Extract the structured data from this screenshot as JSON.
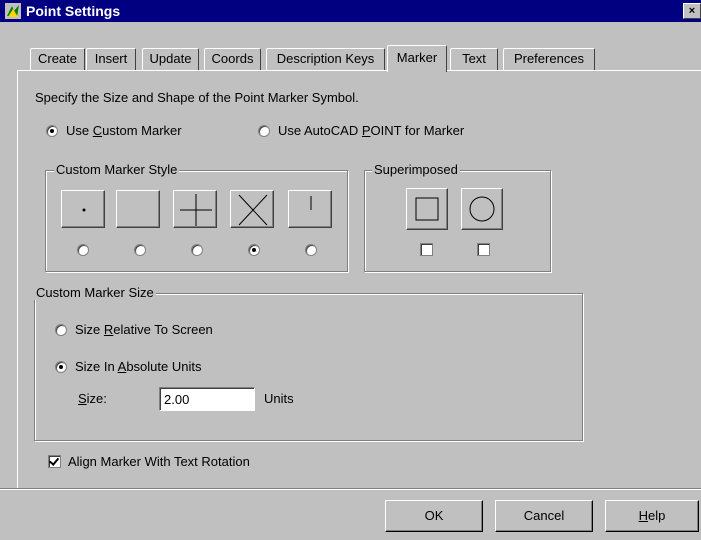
{
  "window": {
    "title": "Point Settings",
    "close_glyph": "×"
  },
  "tabs": [
    {
      "label": "Create",
      "active": false
    },
    {
      "label": "Insert",
      "active": false
    },
    {
      "label": "Update",
      "active": false
    },
    {
      "label": "Coords",
      "active": false
    },
    {
      "label": "Description Keys",
      "active": false
    },
    {
      "label": "Marker",
      "active": true
    },
    {
      "label": "Text",
      "active": false
    },
    {
      "label": "Preferences",
      "active": false
    }
  ],
  "instruction": "Specify the Size and Shape of the Point Marker Symbol.",
  "marker_source": {
    "custom": {
      "pre": "Use ",
      "accel": "C",
      "post": "ustom Marker",
      "selected": true
    },
    "autocad": {
      "pre": "Use AutoCAD ",
      "accel": "P",
      "post": "OINT for Marker",
      "selected": false
    }
  },
  "custom_marker_style": {
    "label": "Custom Marker Style",
    "options": [
      {
        "icon": "dot-marker-icon",
        "selected": false
      },
      {
        "icon": "blank-marker-icon",
        "selected": false
      },
      {
        "icon": "plus-marker-icon",
        "selected": false
      },
      {
        "icon": "cross-marker-icon",
        "selected": true
      },
      {
        "icon": "tick-marker-icon",
        "selected": false
      }
    ]
  },
  "superimposed": {
    "label": "Superimposed",
    "options": [
      {
        "icon": "square-marker-icon",
        "checked": false
      },
      {
        "icon": "circle-marker-icon",
        "checked": false
      }
    ]
  },
  "custom_marker_size": {
    "label": "Custom Marker Size",
    "relative": {
      "pre": "Size ",
      "accel": "R",
      "post": "elative To Screen",
      "selected": false
    },
    "absolute": {
      "pre": "Size In ",
      "accel": "A",
      "post": "bsolute Units",
      "selected": true
    },
    "size_label": {
      "pre": "",
      "accel": "S",
      "post": "ize:"
    },
    "size_value": "2.00",
    "units_label": "Units"
  },
  "align_marker": {
    "label": "Align Marker With Text Rotation",
    "checked": true
  },
  "buttons": {
    "ok": "OK",
    "cancel": "Cancel",
    "help": {
      "pre": "",
      "accel": "H",
      "post": "elp"
    }
  },
  "colors": {
    "title_bar": "#000080",
    "face": "#c0c0c0"
  }
}
